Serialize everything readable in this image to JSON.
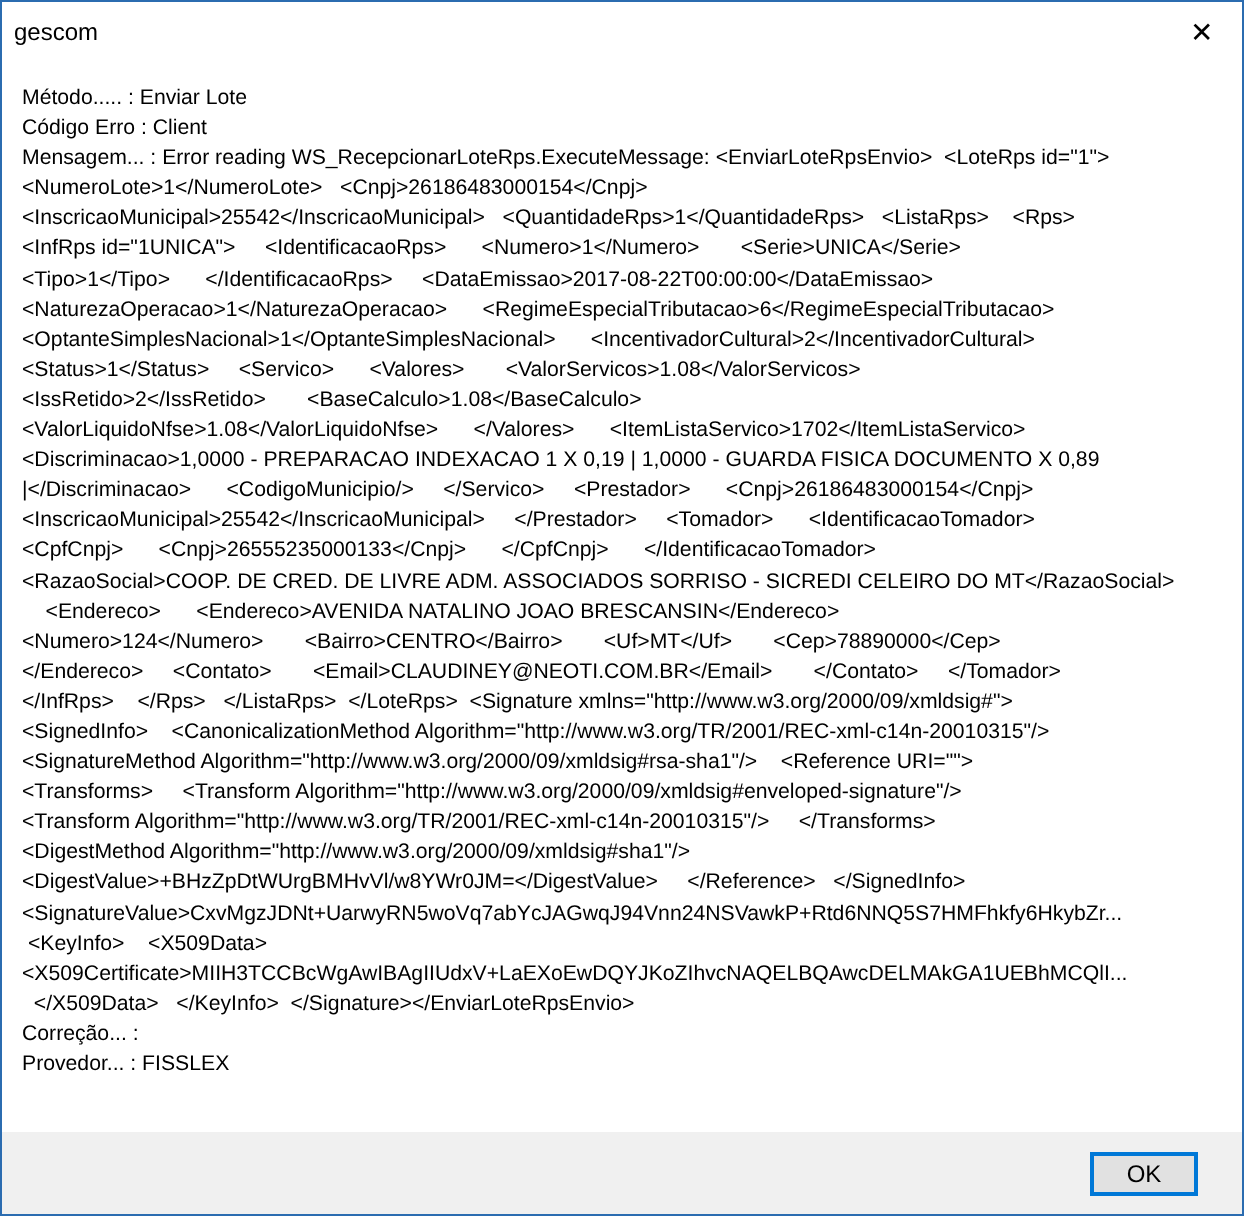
{
  "window": {
    "title": "gescom",
    "close": "✕"
  },
  "message_lines": [
    "Método..... : Enviar Lote",
    "Código Erro : Client",
    "Mensagem... : Error reading WS_RecepcionarLoteRps.ExecuteMessage: <EnviarLoteRpsEnvio>  <LoteRps id=\"1\">",
    "<NumeroLote>1</NumeroLote>   <Cnpj>26186483000154</Cnpj>",
    "<InscricaoMunicipal>25542</InscricaoMunicipal>   <QuantidadeRps>1</QuantidadeRps>   <ListaRps>    <Rps>",
    "<InfRps id=\"1UNICA\">     <IdentificacaoRps>      <Numero>1</Numero>       <Serie>UNICA</Serie>",
    "<Tipo>1</Tipo>      </IdentificacaoRps>     <DataEmissao>2017-08-22T00:00:00</DataEmissao>",
    "<NaturezaOperacao>1</NaturezaOperacao>      <RegimeEspecialTributacao>6</RegimeEspecialTributacao>",
    "<OptanteSimplesNacional>1</OptanteSimplesNacional>      <IncentivadorCultural>2</IncentivadorCultural>",
    "<Status>1</Status>     <Servico>      <Valores>       <ValorServicos>1.08</ValorServicos>",
    "<IssRetido>2</IssRetido>       <BaseCalculo>1.08</BaseCalculo>",
    "<ValorLiquidoNfse>1.08</ValorLiquidoNfse>      </Valores>      <ItemListaServico>1702</ItemListaServico>",
    "<Discriminacao>1,0000 - PREPARACAO INDEXACAO 1 X 0,19 | 1,0000 - GUARDA FISICA DOCUMENTO X 0,89",
    "|</Discriminacao>      <CodigoMunicipio/>     </Servico>     <Prestador>      <Cnpj>26186483000154</Cnpj>",
    "<InscricaoMunicipal>25542</InscricaoMunicipal>     </Prestador>     <Tomador>      <IdentificacaoTomador>",
    "<CpfCnpj>      <Cnpj>26555235000133</Cnpj>      </CpfCnpj>      </IdentificacaoTomador>",
    "<RazaoSocial>COOP. DE CRED. DE LIVRE ADM. ASSOCIADOS SORRISO - SICREDI CELEIRO DO MT</RazaoSocial>",
    "    <Endereco>      <Endereco>AVENIDA NATALINO JOAO BRESCANSIN</Endereco>",
    "<Numero>124</Numero>       <Bairro>CENTRO</Bairro>       <Uf>MT</Uf>       <Cep>78890000</Cep>",
    "</Endereco>     <Contato>       <Email>CLAUDINEY@NEOTI.COM.BR</Email>       </Contato>     </Tomador>",
    "</InfRps>    </Rps>   </ListaRps>  </LoteRps>  <Signature xmlns=\"http://www.w3.org/2000/09/xmldsig#\">",
    "<SignedInfo>    <CanonicalizationMethod Algorithm=\"http://www.w3.org/TR/2001/REC-xml-c14n-20010315\"/>",
    "<SignatureMethod Algorithm=\"http://www.w3.org/2000/09/xmldsig#rsa-sha1\"/>    <Reference URI=\"\">",
    "<Transforms>     <Transform Algorithm=\"http://www.w3.org/2000/09/xmldsig#enveloped-signature\"/>",
    "<Transform Algorithm=\"http://www.w3.org/TR/2001/REC-xml-c14n-20010315\"/>     </Transforms>",
    "<DigestMethod Algorithm=\"http://www.w3.org/2000/09/xmldsig#sha1\"/>",
    "<DigestValue>+BHzZpDtWUrgBMHvVl/w8YWr0JM=</DigestValue>     </Reference>   </SignedInfo>",
    "<SignatureValue>CxvMgzJDNt+UarwyRN5woVq7abYcJAGwqJ94Vnn24NSVawkP+Rtd6NNQ5S7HMFhkfy6HkybZr...",
    " <KeyInfo>    <X509Data>",
    "<X509Certificate>MIIH3TCCBcWgAwIBAgIIUdxV+LaEXoEwDQYJKoZIhvcNAQELBQAwcDELMAkGA1UEBhMCQlI...",
    "  </X509Data>   </KeyInfo>  </Signature></EnviarLoteRpsEnvio>",
    "Correção... :",
    "Provedor... : FISSLEX"
  ],
  "buttons": [
    {
      "label": "OK",
      "default": true
    }
  ]
}
